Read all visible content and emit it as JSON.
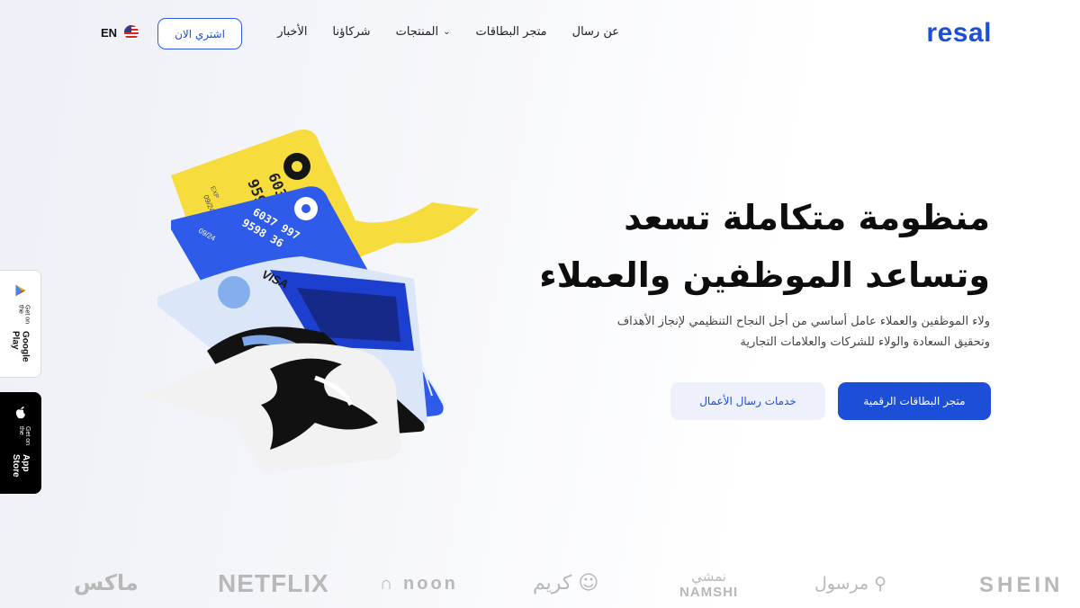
{
  "header": {
    "logo": "resal",
    "nav": [
      {
        "label": "عن رسال",
        "has_dropdown": false
      },
      {
        "label": "متجر البطاقات",
        "has_dropdown": false
      },
      {
        "label": "المنتجات",
        "has_dropdown": true
      },
      {
        "label": "شركاؤنا",
        "has_dropdown": false
      },
      {
        "label": "الأخبار",
        "has_dropdown": false
      }
    ],
    "buy_button": "اشتري الان",
    "language": "EN",
    "language_icon": "us-flag-icon"
  },
  "hero": {
    "title_line1": "منظومة متكاملة تسعد",
    "title_line2": "وتساعد الموظفين والعملاء",
    "description_line1": "ولاء الموظفين والعملاء عامل أساسي من أجل النجاح التنظيمي لإنجاز الأهداف",
    "description_line2": "وتحقيق السعادة والولاء للشركات والعلامات التجارية",
    "primary_button": "متجر البطاقات الرقمية",
    "secondary_button": "خدمات رسال الأعمال"
  },
  "cards": {
    "yellow": {
      "number_1": "603",
      "number_2": "959",
      "exp_label": "EXP",
      "exp": "09/24"
    },
    "blue": {
      "number_1": "6037 997",
      "number_2": "9598 36",
      "exp": "09/24"
    },
    "visa": {
      "brand": "VISA"
    }
  },
  "side_badges": {
    "google_play": {
      "small": "Get on the",
      "big": "Google Play",
      "icon": "google-play-icon"
    },
    "app_store": {
      "small": "Get on the",
      "big": "App Store",
      "icon": "apple-icon"
    }
  },
  "brands": {
    "shein": "SHEIN",
    "mrsool": "مرسول",
    "namshi_ar": "نمشي",
    "namshi_en": "NAMSHI",
    "careem": "كريم",
    "noon": "noon",
    "netflix": "NETFLIX",
    "maxs": "ماكس"
  },
  "colors": {
    "accent": "#1d4ed8",
    "card_yellow": "#f6dc3c",
    "card_blue": "#2f5bea"
  }
}
